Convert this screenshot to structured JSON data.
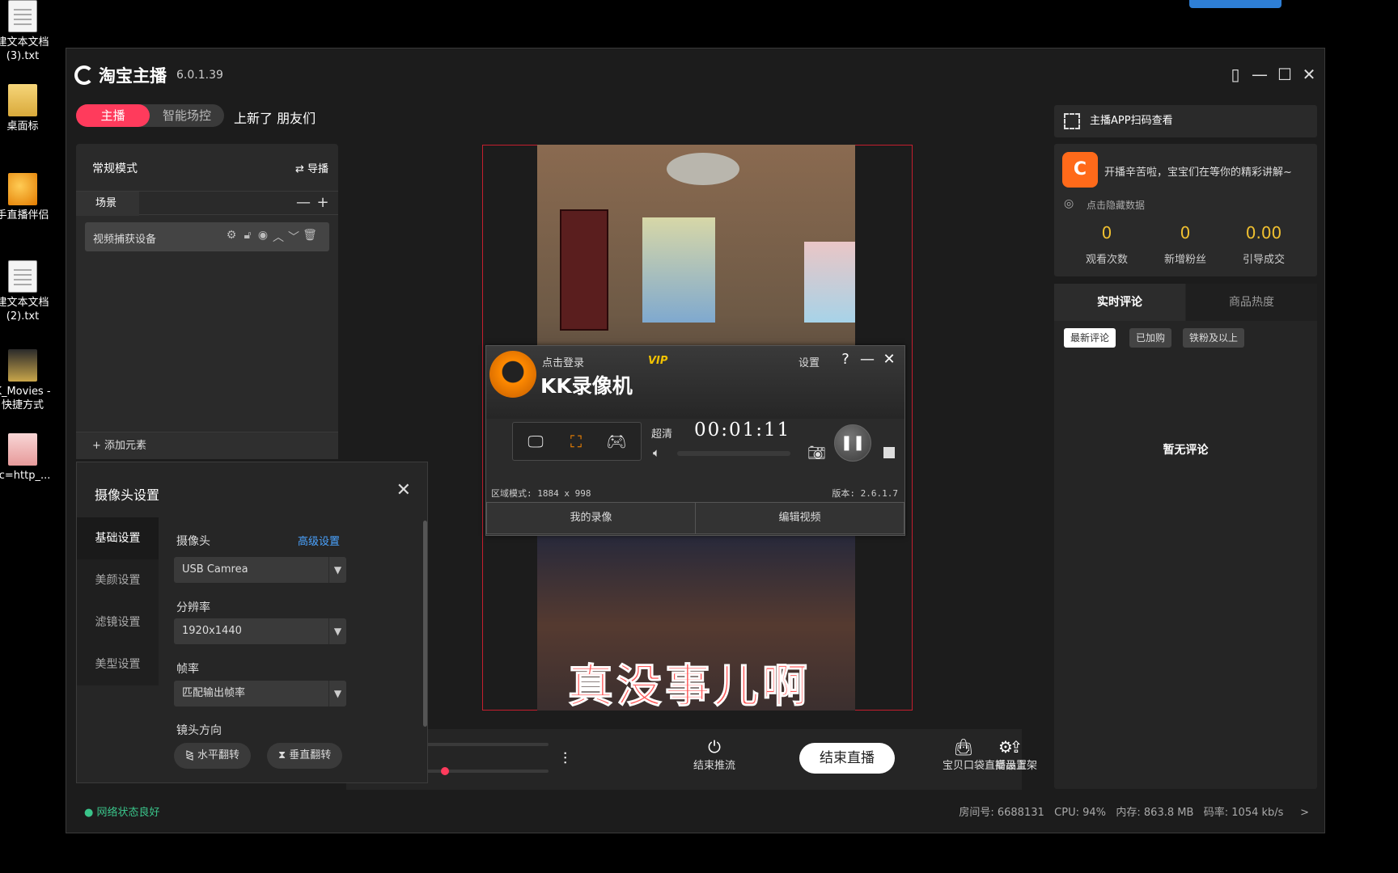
{
  "desktop": {
    "icons": [
      {
        "label": "建文本文档\n(3).txt"
      },
      {
        "label": "桌面标"
      },
      {
        "label": "手直播伴侣"
      },
      {
        "label": "建文本文档\n(2).txt"
      },
      {
        "label": "K_Movies -\n快捷方式"
      },
      {
        "label": "rc=http_..."
      }
    ]
  },
  "window": {
    "app_name": "淘宝主播",
    "version": "6.0.1.39",
    "controls": {
      "page": "▯",
      "minimize": "—",
      "maximize": "☐",
      "close": "✕"
    }
  },
  "mode_toggle": {
    "active": "主播",
    "inactive": "智能场控"
  },
  "banner_text": "上新了 朋友们",
  "left_panel": {
    "title": "常规模式",
    "switch_label": "⇄ 导播",
    "scene_tab": "场景",
    "scene_minus": "—",
    "scene_plus": "+",
    "source_name": "视频捕获设备",
    "add_element": "+ 添加元素"
  },
  "video": {
    "subtitle": "真没事儿啊"
  },
  "kk_recorder": {
    "login": "点击登录",
    "vip": "VIP",
    "name": "KK录像机",
    "settings": "设置",
    "help": "?",
    "minimize": "—",
    "close": "✕",
    "quality": "超清",
    "timer": "00:01:11",
    "pause": "❚❚",
    "area_info": "区域模式: 1884 x 998",
    "version": "版本: 2.6.1.7",
    "my_recordings": "我的录像",
    "edit_video": "编辑视频"
  },
  "bottom_bar": {
    "end_push": "结束推流",
    "end_live": "结束直播",
    "product_bag": "宝贝口袋",
    "product_list": "商品上架",
    "live_settings": "直播设置"
  },
  "camera_dialog": {
    "title": "摄像头设置",
    "close": "✕",
    "nav": [
      "基础设置",
      "美颜设置",
      "滤镜设置",
      "美型设置"
    ],
    "camera_label": "摄像头",
    "advanced": "高级设置",
    "camera_value": "USB Camrea",
    "resolution_label": "分辨率",
    "resolution_value": "1920x1440",
    "framerate_label": "帧率",
    "framerate_value": "匹配输出帧率",
    "direction_label": "镜头方向",
    "flip_h": "水平翻转",
    "flip_v": "垂直翻转"
  },
  "right_panel": {
    "qr_text": "主播APP扫码查看",
    "welcome": "开播辛苦啦，宝宝们在等你的精彩讲解~",
    "hide_data": "点击隐藏数据",
    "stats": [
      {
        "value": "0",
        "label": "观看次数"
      },
      {
        "value": "0",
        "label": "新增粉丝"
      },
      {
        "value": "0.00",
        "label": "引导成交"
      }
    ],
    "tabs": {
      "realtime": "实时评论",
      "heat": "商品热度"
    },
    "chips": [
      "最新评论",
      "已加购",
      "铁粉及以上"
    ],
    "empty": "暂无评论"
  },
  "status_bar": {
    "network": "● 网络状态良好",
    "stats": "房间号: 6688131   CPU: 94%   内存: 863.8 MB   码率: 1054 kb/s     >"
  },
  "accent": "#ff3b5c"
}
